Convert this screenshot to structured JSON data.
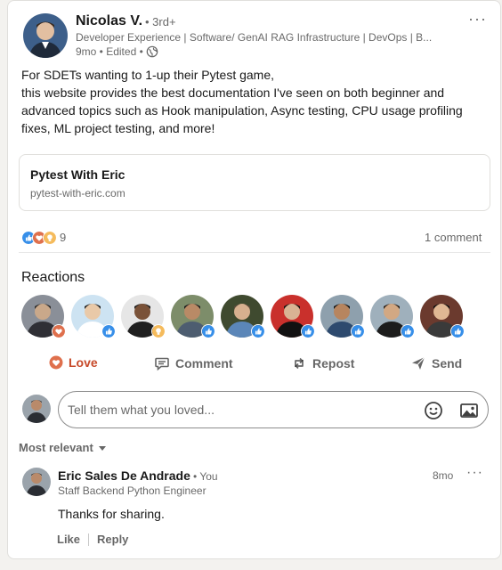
{
  "post": {
    "author": {
      "name": "Nicolas V.",
      "degree": "• 3rd+",
      "headline": "Developer Experience | Software/ GenAI RAG Infrastructure | DevOps | B...",
      "time": "9mo • Edited •",
      "avatar_icon": "person-avatar"
    },
    "more_icon": "ellipsis-icon",
    "more_label": "···",
    "text_lines": [
      "For SDETs wanting to 1-up their Pytest game,",
      "this website provides the best documentation I've seen on both beginner and advanced topics such as Hook manipulation, Async testing, CPU usage profiling fixes, ML project testing, and more!"
    ],
    "link": {
      "title": "Pytest With Eric",
      "domain": "pytest-with-eric.com"
    }
  },
  "social": {
    "reaction_types": [
      "like",
      "love",
      "insightful"
    ],
    "reaction_count": "9",
    "comment_count": "1 comment"
  },
  "reactions": {
    "heading": "Reactions",
    "people": [
      {
        "reaction": "love",
        "skin": "#c9a88a",
        "hair": "#2b2b2b",
        "bg": "#8a8f98",
        "shirt": "#2f2f35"
      },
      {
        "reaction": "like",
        "skin": "#e9c9a8",
        "hair": "#1d1d1d",
        "bg": "#cde3f2",
        "shirt": "#ffffff"
      },
      {
        "reaction": "insightful",
        "skin": "#7a5238",
        "hair": "#1b1b1b",
        "bg": "#e6e6e6",
        "shirt": "#1f1f1f"
      },
      {
        "reaction": "like",
        "skin": "#b98a66",
        "hair": "#1c1c1c",
        "bg": "#7d8d6a",
        "shirt": "#4d5d70"
      },
      {
        "reaction": "like",
        "skin": "#d7b08f",
        "hair": "#5a4a3a",
        "bg": "#3f4a2f",
        "shirt": "#5b86b8"
      },
      {
        "reaction": "like",
        "skin": "#d9b394",
        "hair": "#121212",
        "bg": "#c9302c",
        "shirt": "#111111"
      },
      {
        "reaction": "like",
        "skin": "#b7855f",
        "hair": "#141414",
        "bg": "#8ea0ad",
        "shirt": "#2d4a6e"
      },
      {
        "reaction": "like",
        "skin": "#d2a883",
        "hair": "#2a2118",
        "bg": "#9fb0bc",
        "shirt": "#1c1c1c"
      },
      {
        "reaction": "like",
        "skin": "#e0b894",
        "hair": "#0f0f0f",
        "bg": "#6b3a2e",
        "shirt": "#3a3a3a"
      }
    ]
  },
  "actions": {
    "love": "Love",
    "comment": "Comment",
    "repost": "Repost",
    "send": "Send"
  },
  "composer": {
    "placeholder": "Tell them what you loved...",
    "emoji_icon": "emoji-icon",
    "image_icon": "image-icon"
  },
  "sort": {
    "label": "Most relevant"
  },
  "comment": {
    "author": "Eric Sales De Andrade",
    "you_label": "• You",
    "headline": "Staff Backend Python Engineer",
    "time": "8mo",
    "more_label": "···",
    "text": "Thanks for sharing.",
    "like": "Like",
    "reply": "Reply"
  },
  "colors": {
    "like": "#378fe9",
    "love": "#df704d",
    "insightful": "#f5bb5c",
    "love_active": "#c74a2a",
    "border": "#e0dfdc"
  }
}
